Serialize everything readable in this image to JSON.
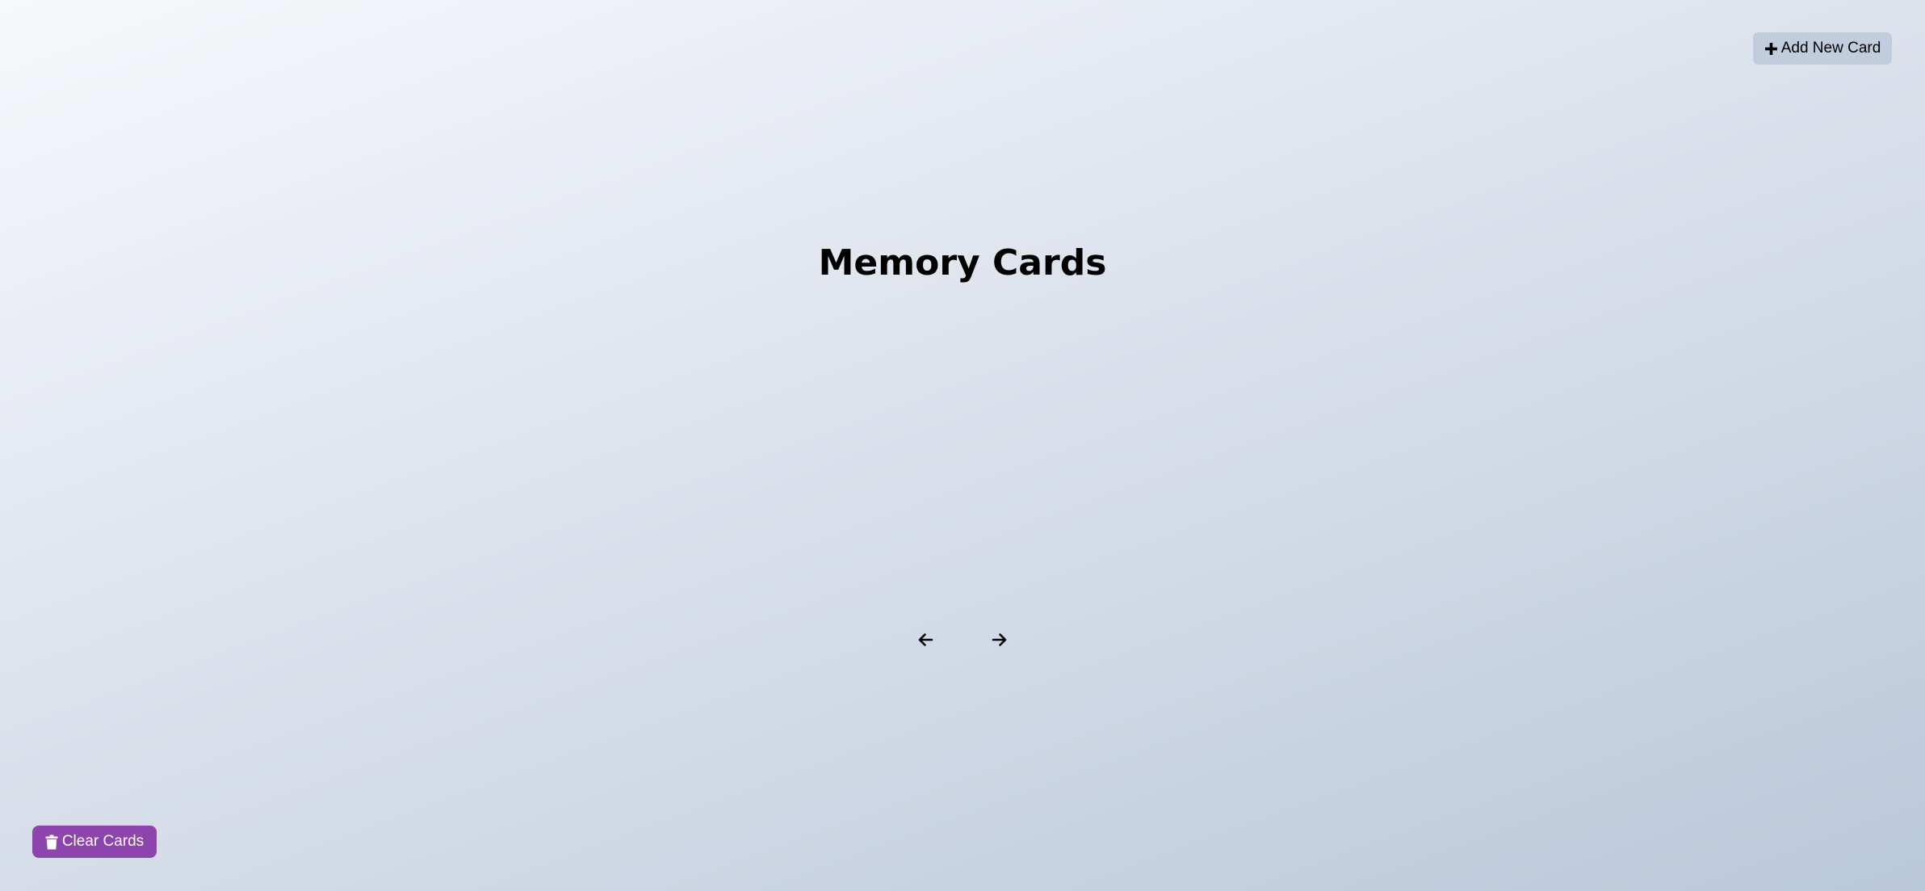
{
  "header": {
    "add_button_label": "Add New Card",
    "add_icon": "plus-icon"
  },
  "main": {
    "title": "Memory Cards"
  },
  "navigation": {
    "prev_icon": "arrow-left-icon",
    "next_icon": "arrow-right-icon"
  },
  "footer": {
    "clear_button_label": "Clear Cards",
    "clear_icon": "trash-icon"
  },
  "colors": {
    "clear_button": "#8e44ad",
    "add_button": "#c1ccdc"
  }
}
